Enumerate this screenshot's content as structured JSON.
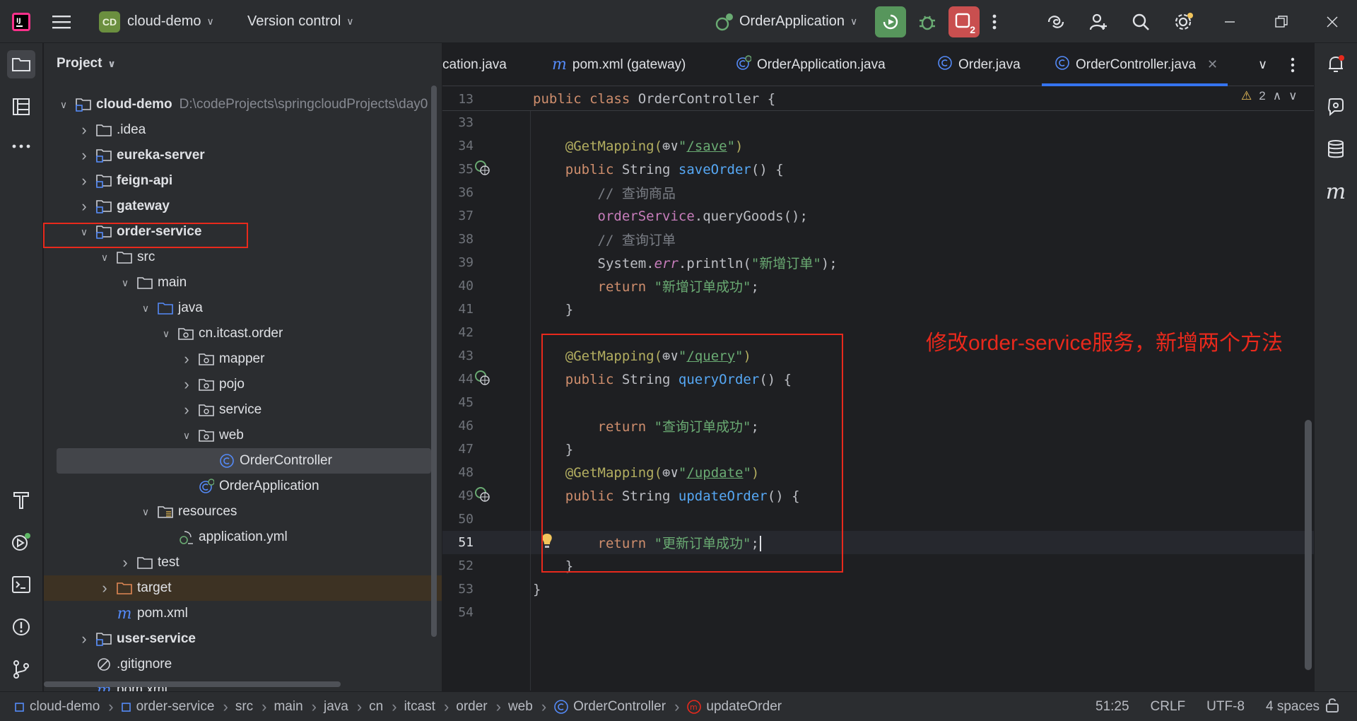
{
  "topbar": {
    "project_badge": "CD",
    "project_name": "cloud-demo",
    "vcs_label": "Version control",
    "run_config": "OrderApplication",
    "stop_count": "2"
  },
  "project_panel": {
    "title": "Project",
    "tree": [
      {
        "label": "cloud-demo",
        "path": "D:\\codeProjects\\springcloudProjects\\day0",
        "bold": true,
        "indent": 0,
        "arrow": "down",
        "icon": "module-folder-icon"
      },
      {
        "label": ".idea",
        "bold": false,
        "indent": 1,
        "arrow": "right",
        "icon": "folder-icon"
      },
      {
        "label": "eureka-server",
        "bold": true,
        "indent": 1,
        "arrow": "right",
        "icon": "module-folder-icon"
      },
      {
        "label": "feign-api",
        "bold": true,
        "indent": 1,
        "arrow": "right",
        "icon": "module-folder-icon"
      },
      {
        "label": "gateway",
        "bold": true,
        "indent": 1,
        "arrow": "right",
        "icon": "module-folder-icon"
      },
      {
        "label": "order-service",
        "bold": true,
        "indent": 1,
        "arrow": "down",
        "icon": "module-folder-icon"
      },
      {
        "label": "src",
        "bold": false,
        "indent": 2,
        "arrow": "down",
        "icon": "folder-icon"
      },
      {
        "label": "main",
        "bold": false,
        "indent": 3,
        "arrow": "down",
        "icon": "folder-icon"
      },
      {
        "label": "java",
        "bold": false,
        "indent": 4,
        "arrow": "down",
        "icon": "source-folder-icon"
      },
      {
        "label": "cn.itcast.order",
        "bold": false,
        "indent": 5,
        "arrow": "down",
        "icon": "package-icon"
      },
      {
        "label": "mapper",
        "bold": false,
        "indent": 6,
        "arrow": "right",
        "icon": "package-icon"
      },
      {
        "label": "pojo",
        "bold": false,
        "indent": 6,
        "arrow": "right",
        "icon": "package-icon"
      },
      {
        "label": "service",
        "bold": false,
        "indent": 6,
        "arrow": "right",
        "icon": "package-icon"
      },
      {
        "label": "web",
        "bold": false,
        "indent": 6,
        "arrow": "down",
        "icon": "package-icon"
      },
      {
        "label": "OrderController",
        "bold": false,
        "indent": 7,
        "arrow": "",
        "icon": "class-icon",
        "selected": true
      },
      {
        "label": "OrderApplication",
        "bold": false,
        "indent": 6,
        "arrow": "",
        "icon": "spring-class-icon"
      },
      {
        "label": "resources",
        "bold": false,
        "indent": 4,
        "arrow": "down",
        "icon": "resources-folder-icon"
      },
      {
        "label": "application.yml",
        "bold": false,
        "indent": 5,
        "arrow": "",
        "icon": "yaml-file-icon"
      },
      {
        "label": "test",
        "bold": false,
        "indent": 3,
        "arrow": "right",
        "icon": "folder-icon"
      },
      {
        "label": "target",
        "bold": false,
        "indent": 2,
        "arrow": "right",
        "icon": "excluded-folder-icon",
        "highlight": true
      },
      {
        "label": "pom.xml",
        "bold": false,
        "indent": 2,
        "arrow": "",
        "icon": "maven-icon"
      },
      {
        "label": "user-service",
        "bold": true,
        "indent": 1,
        "arrow": "right",
        "icon": "module-folder-icon"
      },
      {
        "label": ".gitignore",
        "bold": false,
        "indent": 1,
        "arrow": "",
        "icon": "gitignore-icon"
      },
      {
        "label": "pom.xml",
        "bold": false,
        "indent": 1,
        "arrow": "",
        "icon": "maven-icon"
      }
    ]
  },
  "tabs": [
    {
      "label": "cation.java",
      "icon": ""
    },
    {
      "label": "pom.xml (gateway)",
      "icon": "maven-icon"
    },
    {
      "label": "OrderApplication.java",
      "icon": "spring-class-icon"
    },
    {
      "label": "Order.java",
      "icon": "class-icon"
    },
    {
      "label": "OrderController.java",
      "icon": "class-icon",
      "active": true
    }
  ],
  "editor": {
    "sticky_line_number": "13",
    "sticky_code": "public class OrderController {",
    "warning_count": "2",
    "lines": [
      {
        "n": "33"
      },
      {
        "n": "34",
        "tokens": [
          [
            "ann",
            "    @GetMapping("
          ],
          [
            "plain",
            "⊕∨"
          ],
          [
            "str",
            "\""
          ],
          [
            "url",
            "/save"
          ],
          [
            "str",
            "\""
          ],
          [
            "ann",
            ")"
          ]
        ]
      },
      {
        "n": "35",
        "gutter": true,
        "tokens": [
          [
            "kw",
            "    public "
          ],
          [
            "plain",
            "String "
          ],
          [
            "fn",
            "saveOrder"
          ],
          [
            "plain",
            "() {"
          ]
        ]
      },
      {
        "n": "36",
        "tokens": [
          [
            "cmt",
            "        // 查询商品"
          ]
        ]
      },
      {
        "n": "37",
        "tokens": [
          [
            "fld",
            "        orderService"
          ],
          [
            "plain",
            ".queryGoods();"
          ]
        ]
      },
      {
        "n": "38",
        "tokens": [
          [
            "cmt",
            "        // 查询订单"
          ]
        ]
      },
      {
        "n": "39",
        "tokens": [
          [
            "plain",
            "        System."
          ],
          [
            "itf",
            "err"
          ],
          [
            "plain",
            ".println("
          ],
          [
            "str",
            "\"新增订单\""
          ],
          [
            "plain",
            ");"
          ]
        ]
      },
      {
        "n": "40",
        "tokens": [
          [
            "kw",
            "        return "
          ],
          [
            "str",
            "\"新增订单成功\""
          ],
          [
            "plain",
            ";"
          ]
        ]
      },
      {
        "n": "41",
        "tokens": [
          [
            "plain",
            "    }"
          ]
        ]
      },
      {
        "n": "42"
      },
      {
        "n": "43",
        "tokens": [
          [
            "ann",
            "    @GetMapping("
          ],
          [
            "plain",
            "⊕∨"
          ],
          [
            "str",
            "\""
          ],
          [
            "url",
            "/query"
          ],
          [
            "str",
            "\""
          ],
          [
            "ann",
            ")"
          ]
        ]
      },
      {
        "n": "44",
        "gutter": true,
        "tokens": [
          [
            "kw",
            "    public "
          ],
          [
            "plain",
            "String "
          ],
          [
            "fn",
            "queryOrder"
          ],
          [
            "plain",
            "() {"
          ]
        ]
      },
      {
        "n": "45"
      },
      {
        "n": "46",
        "tokens": [
          [
            "kw",
            "        return "
          ],
          [
            "str",
            "\"查询订单成功\""
          ],
          [
            "plain",
            ";"
          ]
        ]
      },
      {
        "n": "47",
        "tokens": [
          [
            "plain",
            "    }"
          ]
        ]
      },
      {
        "n": "48",
        "tokens": [
          [
            "ann",
            "    @GetMapping("
          ],
          [
            "plain",
            "⊕∨"
          ],
          [
            "str",
            "\""
          ],
          [
            "url",
            "/update"
          ],
          [
            "str",
            "\""
          ],
          [
            "ann",
            ")"
          ]
        ]
      },
      {
        "n": "49",
        "gutter": true,
        "tokens": [
          [
            "kw",
            "    public "
          ],
          [
            "plain",
            "String "
          ],
          [
            "fn",
            "updateOrder"
          ],
          [
            "plain",
            "() {"
          ]
        ]
      },
      {
        "n": "50"
      },
      {
        "n": "51",
        "current": true,
        "tokens": [
          [
            "kw",
            "        return "
          ],
          [
            "str",
            "\"更新订单成功\""
          ],
          [
            "plain",
            ";"
          ]
        ]
      },
      {
        "n": "52",
        "tokens": [
          [
            "plain",
            "    }"
          ]
        ]
      },
      {
        "n": "53",
        "tokens": [
          [
            "plain",
            "}"
          ]
        ]
      },
      {
        "n": "54"
      }
    ],
    "annotation_note": "修改order-service服务，新增两个方法"
  },
  "status": {
    "breadcrumbs": [
      {
        "label": "cloud-demo",
        "icon": "module-icon"
      },
      {
        "label": "order-service",
        "icon": "module-icon"
      },
      {
        "label": "src"
      },
      {
        "label": "main"
      },
      {
        "label": "java"
      },
      {
        "label": "cn"
      },
      {
        "label": "itcast"
      },
      {
        "label": "order"
      },
      {
        "label": "web"
      },
      {
        "label": "OrderController",
        "icon": "class-icon"
      },
      {
        "label": "updateOrder",
        "icon": "method-icon"
      }
    ],
    "position": "51:25",
    "line_sep": "CRLF",
    "encoding": "UTF-8",
    "indent": "4 spaces"
  },
  "colors": {
    "accent": "#3574f0",
    "run_green": "#57965c",
    "stop_red": "#c94f4f",
    "annotation_red": "#e8291c"
  }
}
